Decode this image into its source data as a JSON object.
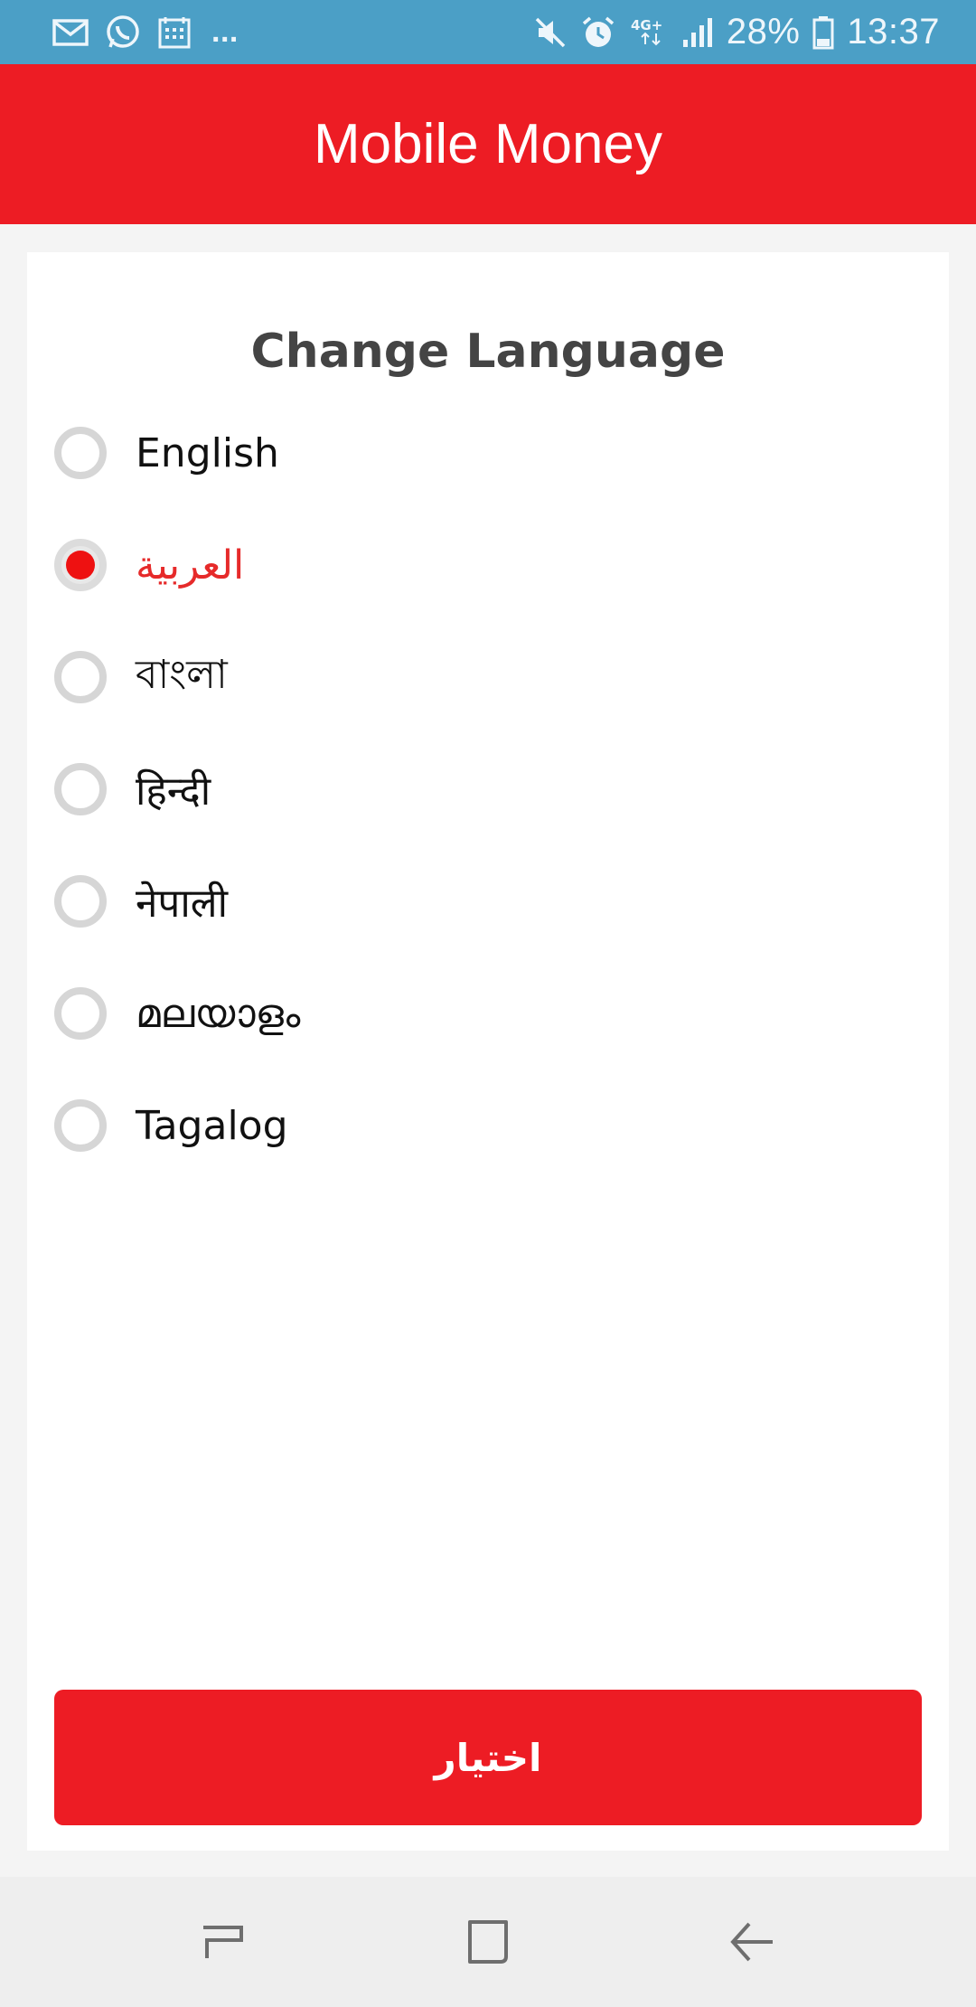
{
  "status_bar": {
    "left_icons": [
      "mail-icon",
      "whatsapp-icon",
      "calendar-icon"
    ],
    "overflow": "...",
    "right_icons": [
      "mute-icon",
      "alarm-icon",
      "network-4g-icon",
      "signal-icon"
    ],
    "network_label": "4G+",
    "battery_percent": "28%",
    "time": "13:37"
  },
  "app_bar": {
    "title": "Mobile Money"
  },
  "dialog": {
    "title": "Change Language",
    "languages": [
      {
        "label": "English",
        "selected": false
      },
      {
        "label": "العربية",
        "selected": true
      },
      {
        "label": "বাংলা",
        "selected": false
      },
      {
        "label": "हिन्दी",
        "selected": false
      },
      {
        "label": "नेपाली",
        "selected": false
      },
      {
        "label": "മലയാളം",
        "selected": false
      },
      {
        "label": "Tagalog",
        "selected": false
      }
    ],
    "select_button": "اختيار"
  },
  "nav_bar": {
    "buttons": [
      "recent-apps-icon",
      "home-icon",
      "back-icon"
    ]
  },
  "colors": {
    "accent": "#ed1c24",
    "status_bar": "#4b9fc6",
    "selected_text": "#e62a2a",
    "radio_border": "#d6d6d6"
  }
}
